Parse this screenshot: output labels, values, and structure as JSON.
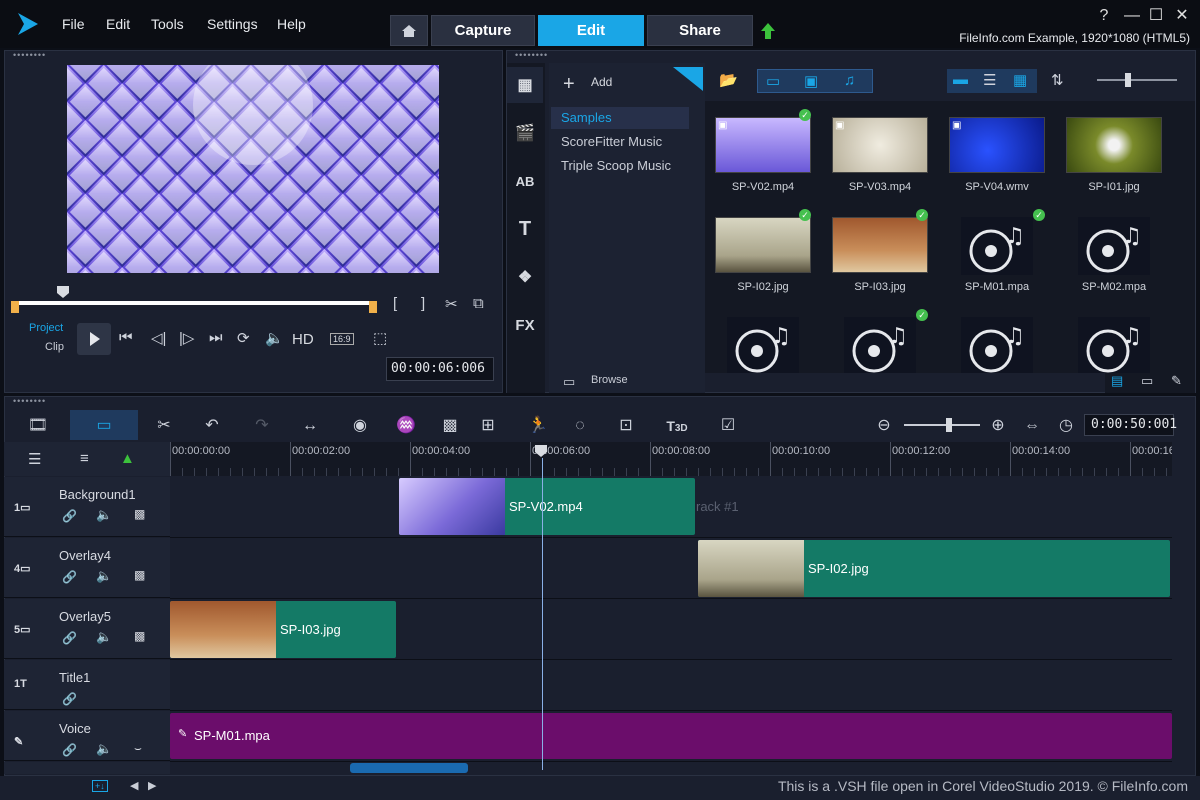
{
  "menu": {
    "file": "File",
    "edit": "Edit",
    "tools": "Tools",
    "settings": "Settings",
    "help": "Help"
  },
  "tabs": [
    {
      "label": "Capture"
    },
    {
      "label": "Edit"
    },
    {
      "label": "Share"
    }
  ],
  "project_info": "FileInfo.com Example, 1920*1080 (HTML5)",
  "player": {
    "project_label": "Project",
    "clip_label": "Clip",
    "hd_label": "HD",
    "aspect_label": "16:9",
    "timecode": "00:00:06:006",
    "mark_in": "[",
    "mark_out": "]"
  },
  "library": {
    "add_label": "Add",
    "folders": [
      {
        "label": "Samples"
      },
      {
        "label": "ScoreFitter Music"
      },
      {
        "label": "Triple Scoop Music"
      }
    ],
    "browse_label": "Browse",
    "side_labels": {
      "title": "T",
      "fx": "FX",
      "ab": "AB"
    },
    "items": [
      {
        "name": "SP-V02.mp4",
        "kind": "video",
        "checked": true
      },
      {
        "name": "SP-V03.mp4",
        "kind": "video",
        "checked": false
      },
      {
        "name": "SP-V04.wmv",
        "kind": "video",
        "checked": false
      },
      {
        "name": "SP-I01.jpg",
        "kind": "image",
        "checked": false
      },
      {
        "name": "SP-I02.jpg",
        "kind": "image",
        "checked": true
      },
      {
        "name": "SP-I03.jpg",
        "kind": "image",
        "checked": true
      },
      {
        "name": "SP-M01.mpa",
        "kind": "audio",
        "checked": true
      },
      {
        "name": "SP-M02.mpa",
        "kind": "audio",
        "checked": false
      },
      {
        "name": "",
        "kind": "audio",
        "checked": false
      },
      {
        "name": "",
        "kind": "audio",
        "checked": true
      },
      {
        "name": "",
        "kind": "audio",
        "checked": false
      },
      {
        "name": "",
        "kind": "audio",
        "checked": false
      }
    ]
  },
  "timeline": {
    "zoom_label": "3D",
    "total_time": "0:00:50:001",
    "ruler": [
      "00:00:00:00",
      "00:00:02:00",
      "00:00:04:00",
      "00:00:06:00",
      "00:00:08:00",
      "00:00:10:00",
      "00:00:12:00",
      "00:00:14:00",
      "00:00:16"
    ],
    "tracks": [
      {
        "name": "Background1",
        "num": "1"
      },
      {
        "name": "Overlay4",
        "num": "4"
      },
      {
        "name": "Overlay5",
        "num": "5"
      },
      {
        "name": "Title1",
        "num": "1"
      },
      {
        "name": "Voice",
        "num": ""
      }
    ],
    "clips": {
      "bg": "SP-V02.mp4",
      "bg_ghost": "rack #1",
      "ov4": "SP-I02.jpg",
      "ov5": "SP-I03.jpg",
      "voice": "SP-M01.mpa"
    }
  },
  "status": "This is a .VSH file open in Corel VideoStudio 2019. © FileInfo.com"
}
